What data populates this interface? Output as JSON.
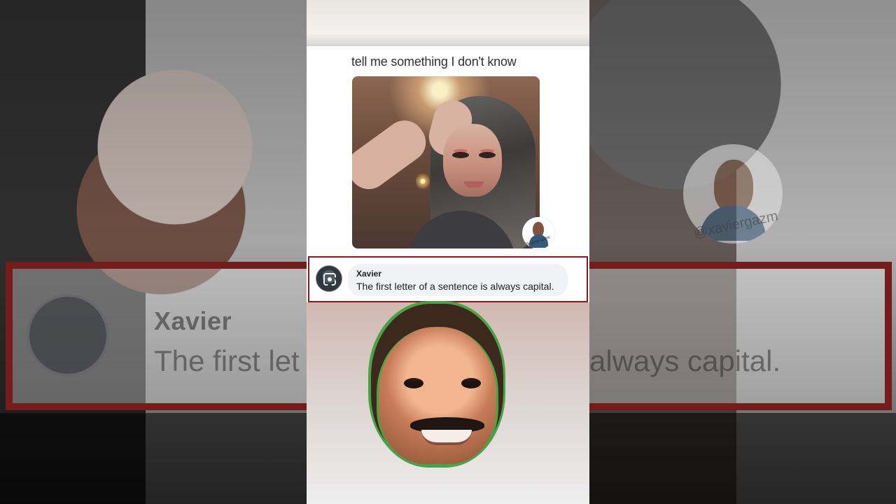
{
  "post": {
    "title": "tell me something I don't know",
    "watermark": "@xaviergazm"
  },
  "comment": {
    "author": "Xavier",
    "text": "The first letter of a sentence is always capital."
  },
  "background": {
    "author": "Xavier",
    "comment_left": "The first let",
    "comment_right": "always capital.",
    "watermark": "@xaviergazm"
  },
  "icons": {
    "comment_avatar": "scan-icon",
    "creator_avatar": "profile-icon"
  },
  "colors": {
    "comment_border": "#7c1c1c",
    "comment_bubble": "#f0f2f5",
    "reaction_outline": "#47a541"
  }
}
